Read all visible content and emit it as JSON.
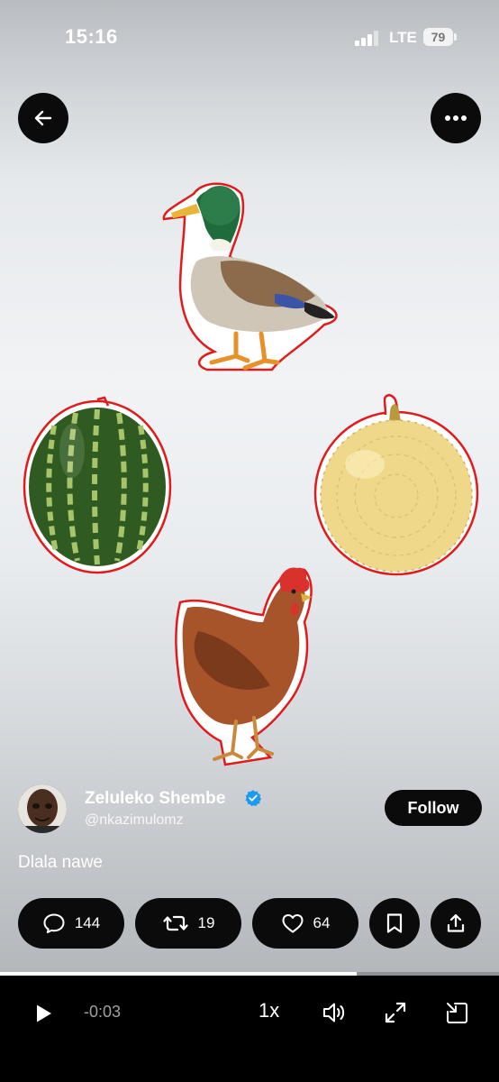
{
  "status_bar": {
    "time": "15:16",
    "network": "LTE",
    "battery": "79"
  },
  "top_bar": {
    "back_icon": "arrow-left-icon",
    "more_icon": "more-horizontal-icon"
  },
  "media": {
    "items": [
      "duck",
      "watermelon",
      "cantaloupe-melon",
      "chicken"
    ]
  },
  "author": {
    "name": "Zeluleko Shembe",
    "handle": "@nkazimulomz",
    "verified": true,
    "follow_label": "Follow"
  },
  "post": {
    "text": "Dlala nawe"
  },
  "actions": {
    "replies": "144",
    "reposts": "19",
    "likes": "64"
  },
  "player": {
    "progress": 0.715,
    "time_remaining": "-0:03",
    "speed": "1x"
  },
  "colors": {
    "accent_verified": "#1d9bf0",
    "button_bg": "#0b0b0b",
    "outline": "#e01b1b"
  }
}
